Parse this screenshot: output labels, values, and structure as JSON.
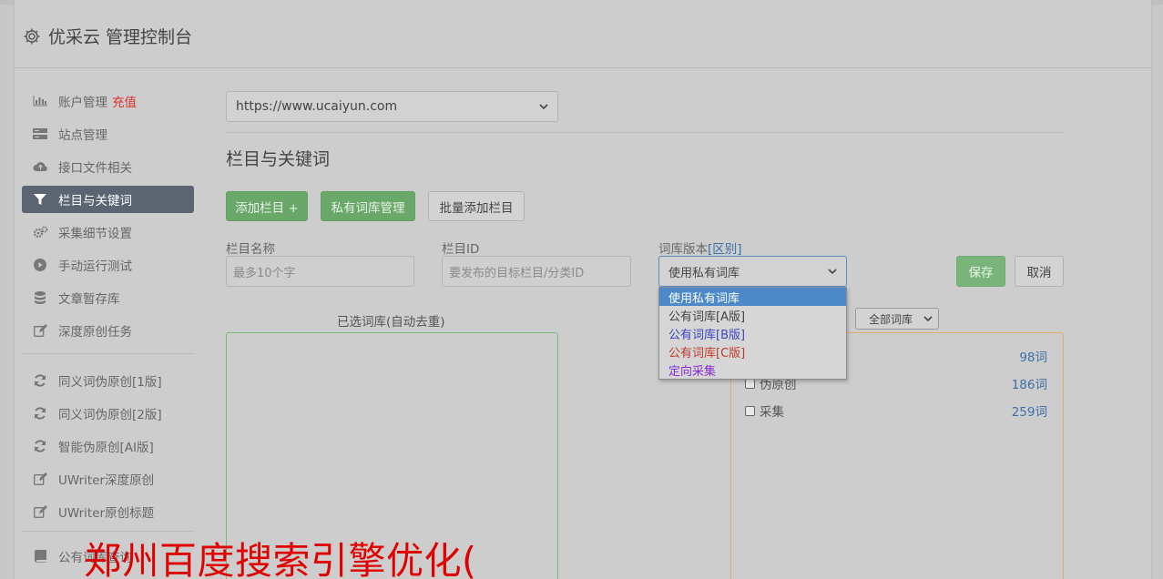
{
  "app": {
    "title": "优采云 管理控制台"
  },
  "sidebar": {
    "items": [
      {
        "icon": "bar-chart-icon",
        "label": "账户管理",
        "badge": "充值"
      },
      {
        "icon": "server-icon",
        "label": "站点管理"
      },
      {
        "icon": "cloud-upload-icon",
        "label": "接口文件相关"
      },
      {
        "icon": "filter-icon",
        "label": "栏目与关键词",
        "active": true
      },
      {
        "icon": "cogs-icon",
        "label": "采集细节设置"
      },
      {
        "icon": "play-circle-icon",
        "label": "手动运行测试"
      },
      {
        "icon": "database-icon",
        "label": "文章暂存库"
      },
      {
        "icon": "edit-icon",
        "label": "深度原创任务"
      }
    ],
    "items2": [
      {
        "icon": "refresh-icon",
        "label": "同义词伪原创[1版]"
      },
      {
        "icon": "refresh-icon",
        "label": "同义词伪原创[2版]"
      },
      {
        "icon": "refresh-icon",
        "label": "智能伪原创[AI版]"
      },
      {
        "icon": "edit-icon",
        "label": "UWriter深度原创"
      },
      {
        "icon": "edit-icon",
        "label": "UWriter原创标题"
      }
    ],
    "items3": [
      {
        "icon": "book-icon",
        "label": "公有词库查询"
      }
    ]
  },
  "main": {
    "site_select": "https://www.ucaiyun.com",
    "section_title": "栏目与关键词",
    "buttons": {
      "add_column": "添加栏目 +",
      "private_lib": "私有词库管理",
      "batch_add": "批量添加栏目"
    },
    "form": {
      "name_label": "栏目名称",
      "name_placeholder": "最多10个字",
      "id_label": "栏目ID",
      "id_placeholder": "要发布的目标栏目/分类ID",
      "version_label": "词库版本",
      "version_link": "[区别]",
      "version_value": "使用私有词库",
      "save": "保存",
      "cancel": "取消"
    },
    "dropdown": {
      "options": [
        {
          "label": "使用私有词库",
          "color": "#ffffff",
          "selected": true
        },
        {
          "label": "公有词库[A版]",
          "color": "#444444"
        },
        {
          "label": "公有词库[B版]",
          "color": "#3a45c4"
        },
        {
          "label": "公有词库[C版]",
          "color": "#c0392b"
        },
        {
          "label": "定向采集",
          "color": "#8a2bd8"
        }
      ]
    },
    "selected_caption": "已选词库(自动去重)",
    "filter_select": "全部词库",
    "libraries": [
      {
        "label": "",
        "count": "98词"
      },
      {
        "label": "伪原创",
        "count": "186词"
      },
      {
        "label": "采集",
        "count": "259词"
      }
    ]
  },
  "watermark": "郑州百度搜索引擎优化("
}
